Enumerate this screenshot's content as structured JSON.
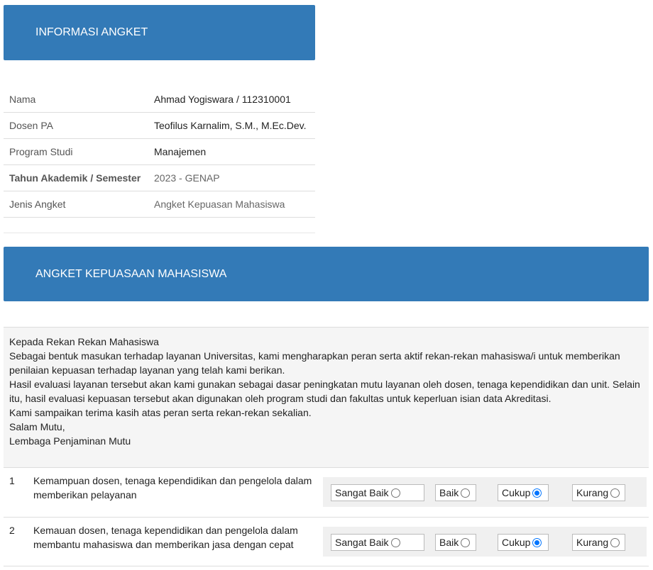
{
  "info_panel": {
    "title": "INFORMASI ANGKET",
    "rows": [
      {
        "label": "Nama",
        "value": "Ahmad Yogiswara / 112310001"
      },
      {
        "label": "Dosen PA",
        "value": "Teofilus Karnalim, S.M., M.Ec.Dev."
      },
      {
        "label": "Program Studi",
        "value": "Manajemen"
      },
      {
        "label": "Tahun Akademik / Semester",
        "value": "2023 - GENAP"
      },
      {
        "label": "Jenis Angket",
        "value": "Angket Kepuasan Mahasiswa"
      }
    ]
  },
  "survey_panel": {
    "title": "ANGKET KEPUASAAN MAHASISWA",
    "intro": [
      "Kepada Rekan Rekan Mahasiswa",
      "Sebagai bentuk masukan terhadap layanan Universitas, kami mengharapkan peran serta aktif rekan-rekan mahasiswa/i untuk memberikan penilaian kepuasan terhadap layanan yang telah kami berikan.",
      "Hasil evaluasi layanan tersebut akan kami gunakan sebagai dasar peningkatan mutu layanan oleh dosen, tenaga kependidikan dan unit. Selain itu, hasil evaluasi kepuasan tersebut akan digunakan oleh program studi dan fakultas untuk keperluan isian data Akreditasi.",
      "Kami sampaikan terima kasih atas peran serta rekan-rekan sekalian.",
      "Salam Mutu,",
      "Lembaga Penjaminan Mutu"
    ],
    "options": [
      "Sangat Baik",
      "Baik",
      "Cukup",
      "Kurang"
    ],
    "questions": [
      {
        "no": "1",
        "text": "Kemampuan dosen, tenaga kependidikan dan pengelola dalam memberikan pelayanan",
        "selected": "Cukup"
      },
      {
        "no": "2",
        "text": "Kemauan dosen, tenaga kependidikan dan pengelola dalam membantu mahasiswa dan memberikan jasa dengan cepat",
        "selected": "Cukup"
      }
    ]
  },
  "colors": {
    "panel_header": "#337ab7",
    "radio_checked": "#0075ff"
  }
}
